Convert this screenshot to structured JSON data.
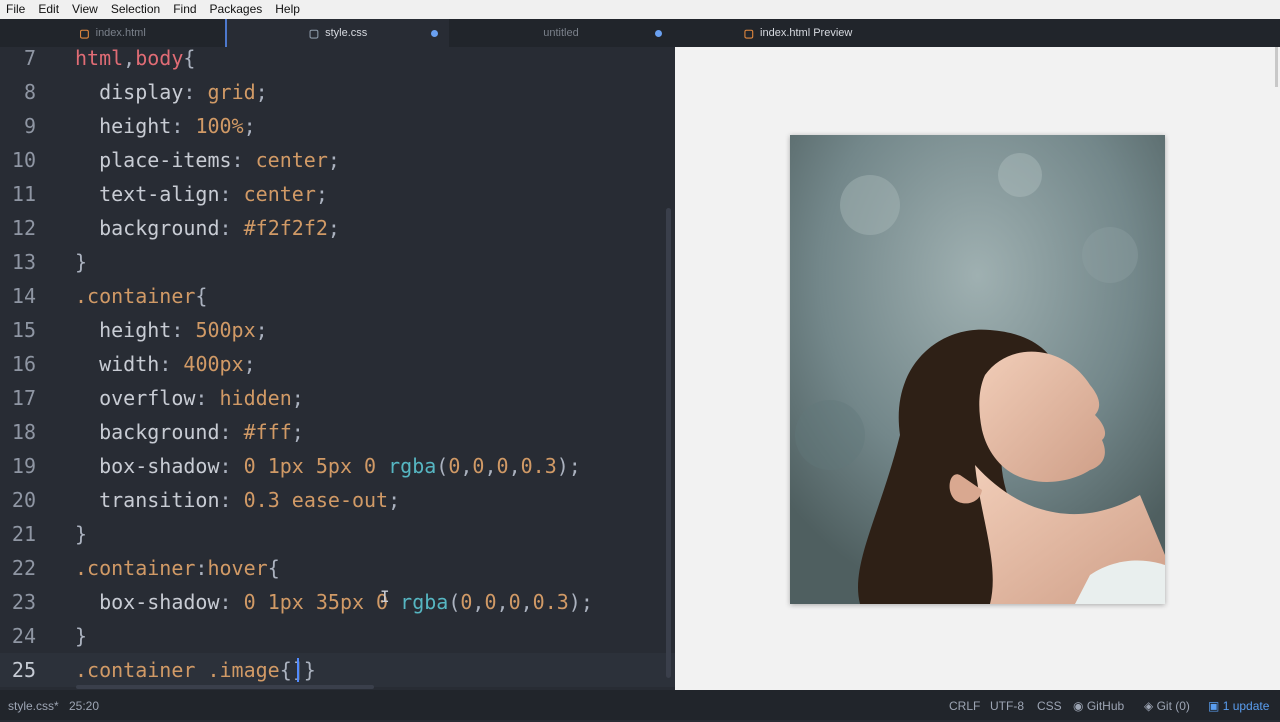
{
  "menu": [
    "File",
    "Edit",
    "View",
    "Selection",
    "Find",
    "Packages",
    "Help"
  ],
  "tabs": [
    {
      "label": "index.html",
      "icon": "html-file-icon"
    },
    {
      "label": "style.css",
      "icon": "css-file-icon",
      "modified": true
    },
    {
      "label": "untitled",
      "modified": true
    },
    {
      "label": "index.html Preview",
      "icon": "html-file-icon"
    }
  ],
  "editor": {
    "line_numbers": [
      "7",
      "8",
      "9",
      "10",
      "11",
      "12",
      "13",
      "14",
      "15",
      "16",
      "17",
      "18",
      "19",
      "20",
      "21",
      "22",
      "23",
      "24",
      "25"
    ],
    "current_line": "25"
  },
  "status": {
    "file": "style.css*",
    "cursor": "25:20",
    "line_ending": "CRLF",
    "encoding": "UTF-8",
    "grammar": "CSS",
    "github": "GitHub",
    "git": "Git (0)",
    "update": "1 update"
  },
  "colors": {
    "editor_bg": "#282c34",
    "selector": "#e06c75",
    "value": "#d19a66",
    "function": "#56b6c2",
    "accent": "#528bff"
  }
}
